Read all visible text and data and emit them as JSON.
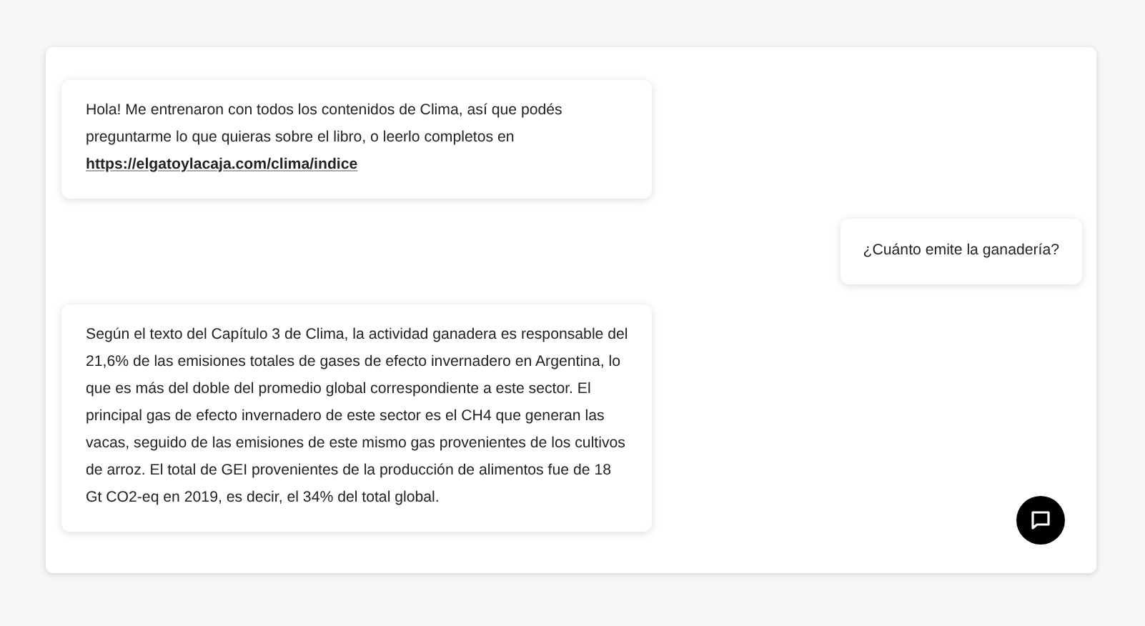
{
  "messages": [
    {
      "kind": "bot",
      "text": "Hola! Me entrenaron con todos los contenidos de Clima, así que podés preguntarme lo que quieras sobre el libro, o leerlo completos en",
      "link": "https://elgatoylacaja.com/clima/indice"
    },
    {
      "kind": "user",
      "text": "¿Cuánto emite la ganadería?"
    },
    {
      "kind": "bot",
      "text": "Según el texto del Capítulo 3 de Clima, la actividad ganadera es responsable del 21,6% de las emisiones totales de gases de efecto invernadero en Argentina, lo que es más del doble del promedio global correspondiente a este sector. El principal gas de efecto invernadero de este sector es el CH4 que generan las vacas, seguido de las emisiones de este mismo gas provenientes de los cultivos de arroz. El total de GEI provenientes de la producción de alimentos fue de 18 Gt CO2-eq en 2019, es decir, el 34% del total global."
    }
  ]
}
